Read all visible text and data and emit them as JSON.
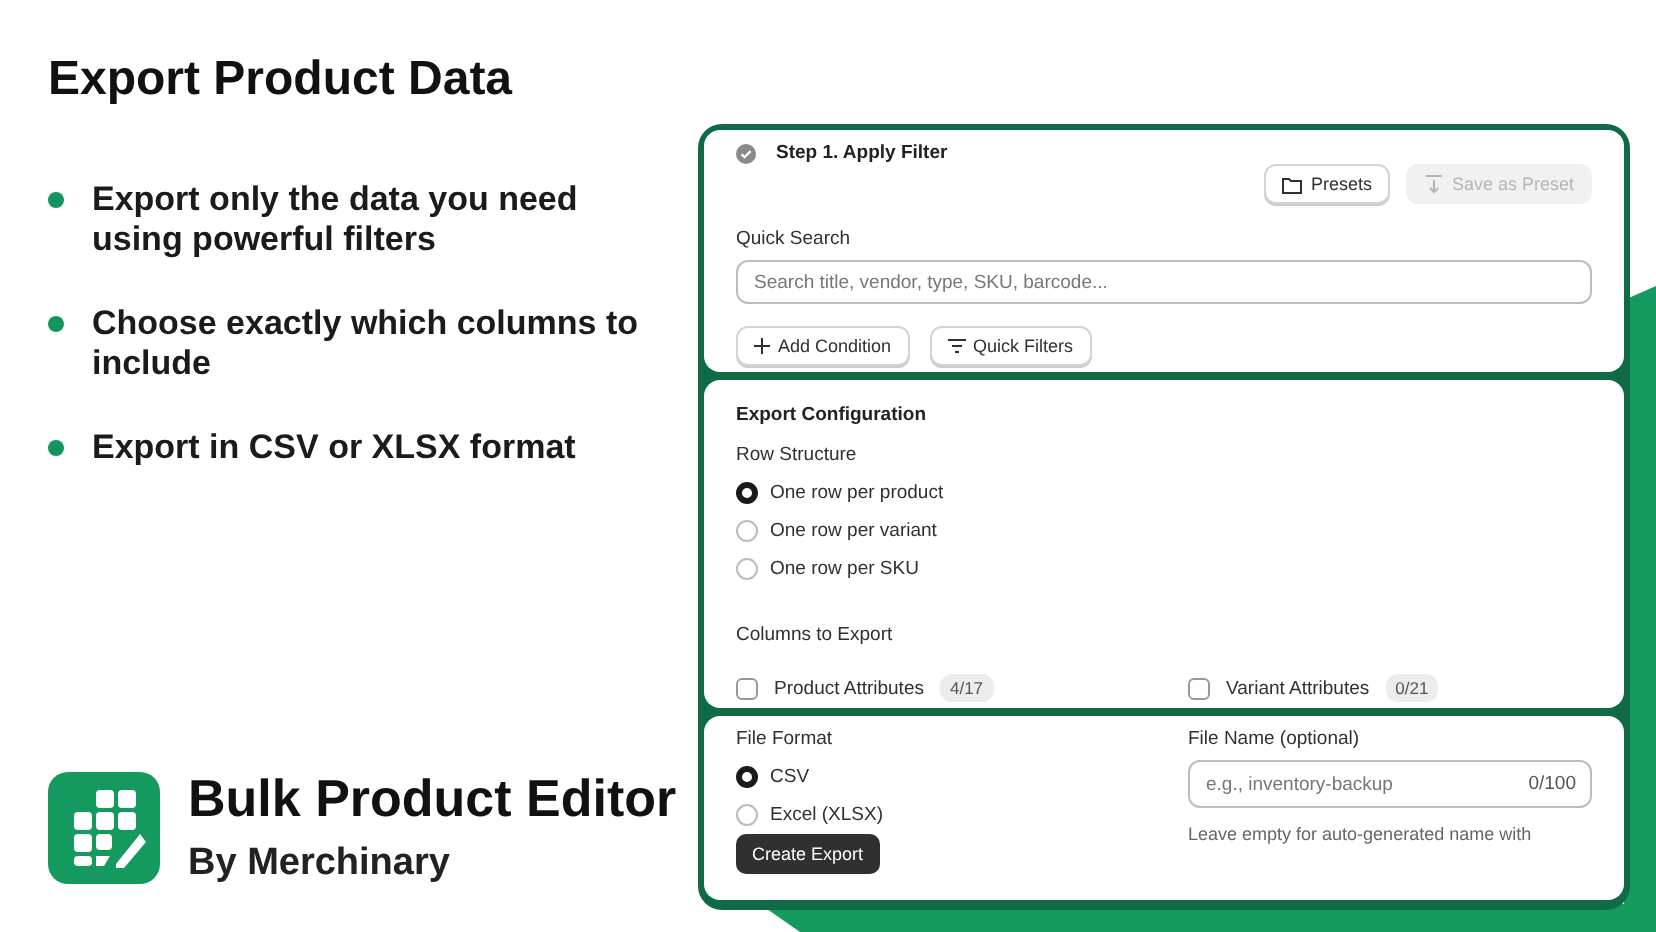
{
  "title": "Export Product Data",
  "features": [
    "Export only the data you need using powerful filters",
    "Choose exactly which columns to include",
    "Export in CSV or XLSX format"
  ],
  "brand": {
    "name": "Bulk Product Editor",
    "byline": "By Merchinary"
  },
  "filter": {
    "step": "Step 1. Apply Filter",
    "done": true,
    "presets": {
      "label": "Presets",
      "disabled": false
    },
    "save_preset": {
      "label": "Save as Preset",
      "disabled": true
    },
    "search_label": "Quick Search",
    "search_placeholder": "Search title, vendor, type, SKU, barcode...",
    "add_condition": "Add Condition",
    "quick_filters": "Quick Filters"
  },
  "config": {
    "heading": "Export Configuration",
    "row_structure_label": "Row Structure",
    "row_options": [
      {
        "label": "One row per product",
        "selected": true
      },
      {
        "label": "One row per variant",
        "selected": false
      },
      {
        "label": "One row per SKU",
        "selected": false
      }
    ],
    "columns_label": "Columns to Export",
    "column_groups": [
      {
        "label": "Product Attributes",
        "count": "4/17",
        "checked": false
      },
      {
        "label": "Variant Attributes",
        "count": "0/21",
        "checked": false
      }
    ]
  },
  "output": {
    "format_label": "File Format",
    "formats": [
      {
        "label": "CSV",
        "selected": true
      },
      {
        "label": "Excel (XLSX)",
        "selected": false
      }
    ],
    "create_button": "Create Export",
    "file_name_label": "File Name (optional)",
    "file_name_placeholder": "e.g., inventory-backup",
    "file_name_counter": "0/100",
    "file_name_hint": "Leave empty for auto-generated name with"
  }
}
